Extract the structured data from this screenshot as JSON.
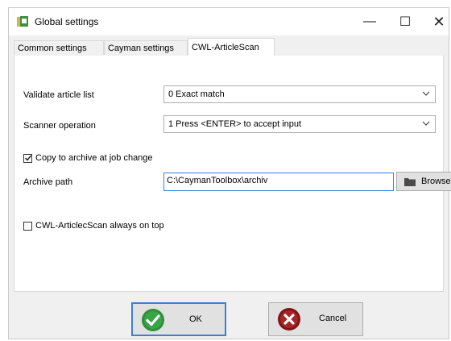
{
  "window": {
    "title": "Global settings",
    "controls": {
      "minimize": "—",
      "maximize": "☐",
      "close": "✕"
    }
  },
  "tabs": [
    {
      "label": "Common settings"
    },
    {
      "label": "Cayman settings"
    },
    {
      "label": "CWL-ArticleScan",
      "active": true
    }
  ],
  "form": {
    "validate": {
      "label": "Validate article list",
      "value": "0 Exact match"
    },
    "scanner": {
      "label": "Scanner operation",
      "value": "1 Press <ENTER> to accept input"
    },
    "copy_archive": {
      "label": "Copy to archive at job change",
      "checked": true
    },
    "archive_path": {
      "label": "Archive path",
      "value": "C:\\CaymanToolbox\\archiv"
    },
    "browse_label": "Browse",
    "always_on_top": {
      "label": "CWL-ArticlecScan always on top",
      "checked": false
    }
  },
  "footer": {
    "ok_label": "OK",
    "cancel_label": "Cancel"
  },
  "icons": {
    "app": "app-icon",
    "chevron": "chevron-down-icon",
    "folder": "folder-icon",
    "ok": "check-icon",
    "cancel": "cancel-icon"
  },
  "colors": {
    "ok_green": "#2f8f3a",
    "cancel_red": "#9b1b1b",
    "focus_blue": "#3c7fd6"
  }
}
